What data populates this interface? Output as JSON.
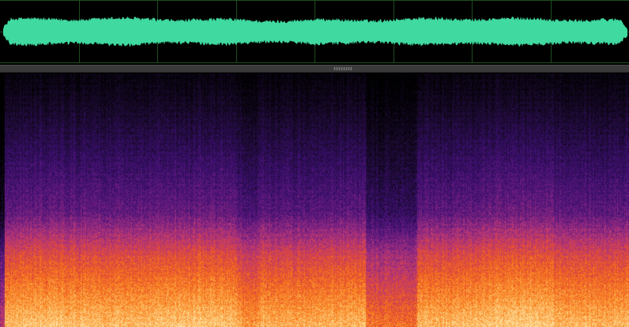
{
  "waveform": {
    "color": "#40d9a0",
    "grid_color": "#1f4d1f",
    "background": "#000000",
    "grid_divisions": 8
  },
  "splitter": {
    "color": "#3a3a3a",
    "grip_color": "#7a7a7a"
  },
  "spectrogram": {
    "colormap": [
      "#000000",
      "#1a0a2e",
      "#3b0f70",
      "#721f81",
      "#b5367a",
      "#e34a33",
      "#f97c1a",
      "#fcb55a",
      "#fde6a8"
    ],
    "background": "#050308"
  }
}
